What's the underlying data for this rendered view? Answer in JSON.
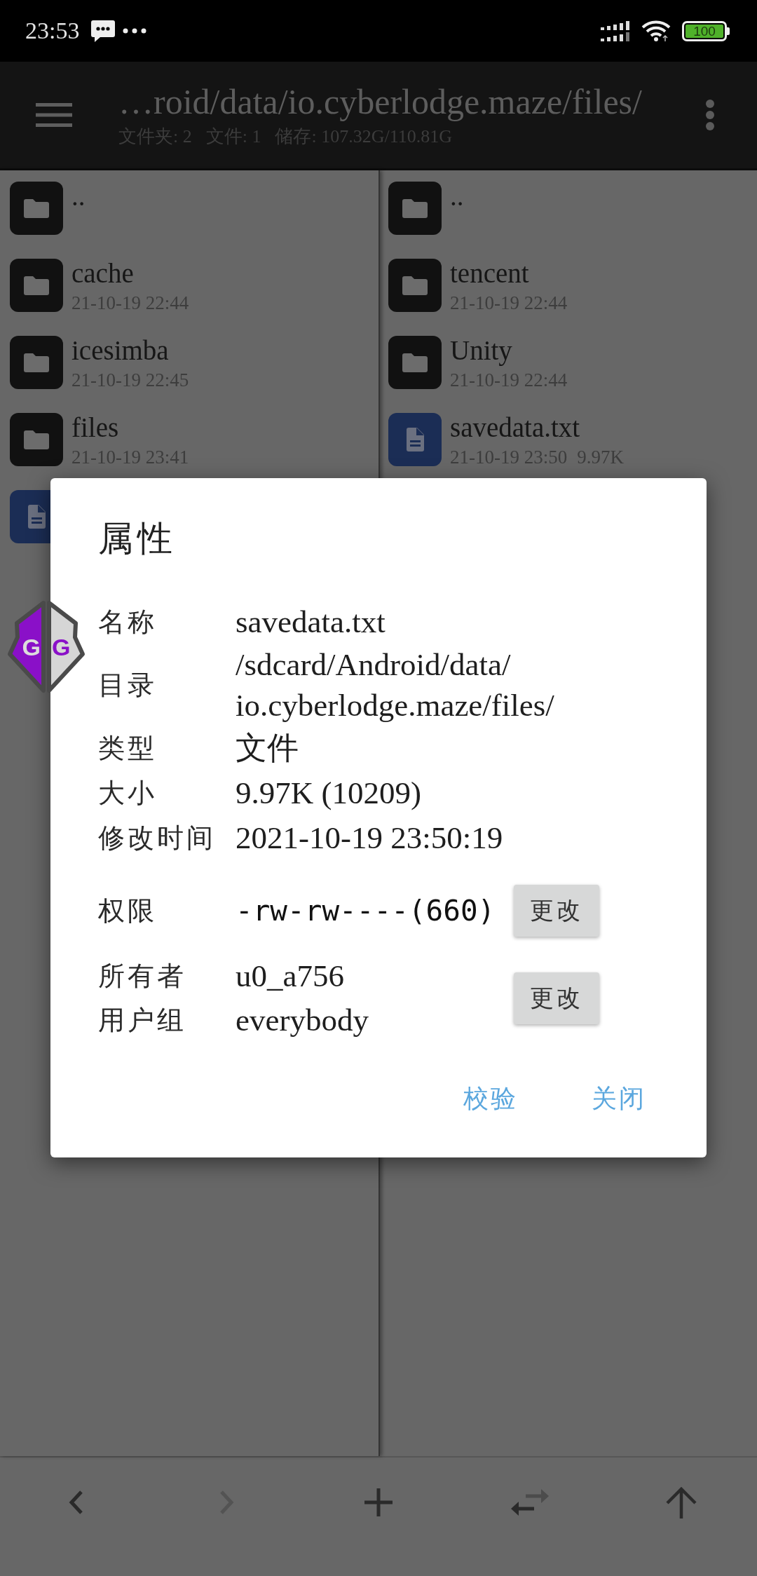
{
  "status_bar": {
    "time": "23:53",
    "battery": "100"
  },
  "toolbar": {
    "path": "…roid/data/io.cyberlodge.maze/files/",
    "stats": [
      "文件夹: 2",
      "文件: 1",
      "储存: 107.32G/110.81G"
    ]
  },
  "panes": [
    {
      "items": [
        {
          "kind": "folder",
          "name": ".."
        },
        {
          "kind": "folder",
          "name": "cache",
          "date": "21-10-19 22:44"
        },
        {
          "kind": "folder",
          "name": "icesimba",
          "date": "21-10-19 22:45"
        },
        {
          "kind": "folder",
          "name": "files",
          "date": "21-10-19 23:41"
        },
        {
          "kind": "file"
        }
      ]
    },
    {
      "items": [
        {
          "kind": "folder",
          "name": ".."
        },
        {
          "kind": "folder",
          "name": "tencent",
          "date": "21-10-19 22:44"
        },
        {
          "kind": "folder",
          "name": "Unity",
          "date": "21-10-19 22:44"
        },
        {
          "kind": "file",
          "name": "savedata.txt",
          "date": "21-10-19 23:50",
          "size": "9.97K"
        }
      ]
    }
  ],
  "floating_button": {
    "letters": [
      "G",
      "G"
    ]
  },
  "dialog": {
    "title": "属性",
    "fields": [
      {
        "label": "名称",
        "lines": [
          "savedata.txt"
        ]
      },
      {
        "label": "目录",
        "lines": [
          "/sdcard/Android/data/",
          "io.cyberlodge.maze/files/"
        ]
      },
      {
        "label": "类型",
        "lines": [
          "文件"
        ]
      },
      {
        "label": "大小",
        "lines": [
          "9.97K (10209)"
        ]
      },
      {
        "label": "修改时间",
        "lines": [
          "2021-10-19 23:50:19"
        ]
      }
    ],
    "permission": {
      "label": "权限",
      "value": "-rw-rw----(660)",
      "button": "更改"
    },
    "ownership": {
      "fields": [
        {
          "label": "所有者",
          "value": "u0_a756"
        },
        {
          "label": "用户组",
          "value": "everybody"
        }
      ],
      "button": "更改"
    },
    "actions": [
      "校验",
      "关闭"
    ]
  },
  "bottom_bar": [
    {
      "kind": "back",
      "disabled": false
    },
    {
      "kind": "forward",
      "disabled": true
    },
    {
      "kind": "add",
      "disabled": false
    },
    {
      "kind": "swap",
      "disabled": false
    },
    {
      "kind": "up",
      "disabled": false
    }
  ]
}
